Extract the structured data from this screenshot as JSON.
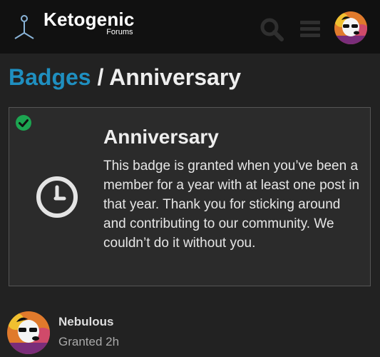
{
  "site": {
    "title": "Ketogenic",
    "subtitle": "Forums"
  },
  "header": {
    "icons": [
      "search-icon",
      "hamburger-menu-icon",
      "user-avatar"
    ]
  },
  "breadcrumb": {
    "parent": "Badges",
    "separator": " / ",
    "current": "Anniversary"
  },
  "badge": {
    "name": "Anniversary",
    "description": "This badge is granted when you’ve been a member for a year with at least one post in that year. Thank you for sticking around and contributing to our community. We couldn’t do it without you.",
    "icon": "clock-icon",
    "granted_icon": "check-circle-icon"
  },
  "grants": [
    {
      "username": "Nebulous",
      "granted": "Granted 2h"
    }
  ],
  "colors": {
    "background": "#222222",
    "header": "#111111",
    "link": "#1f8fc0",
    "granted": "#1ca551",
    "card_border": "#555555"
  }
}
